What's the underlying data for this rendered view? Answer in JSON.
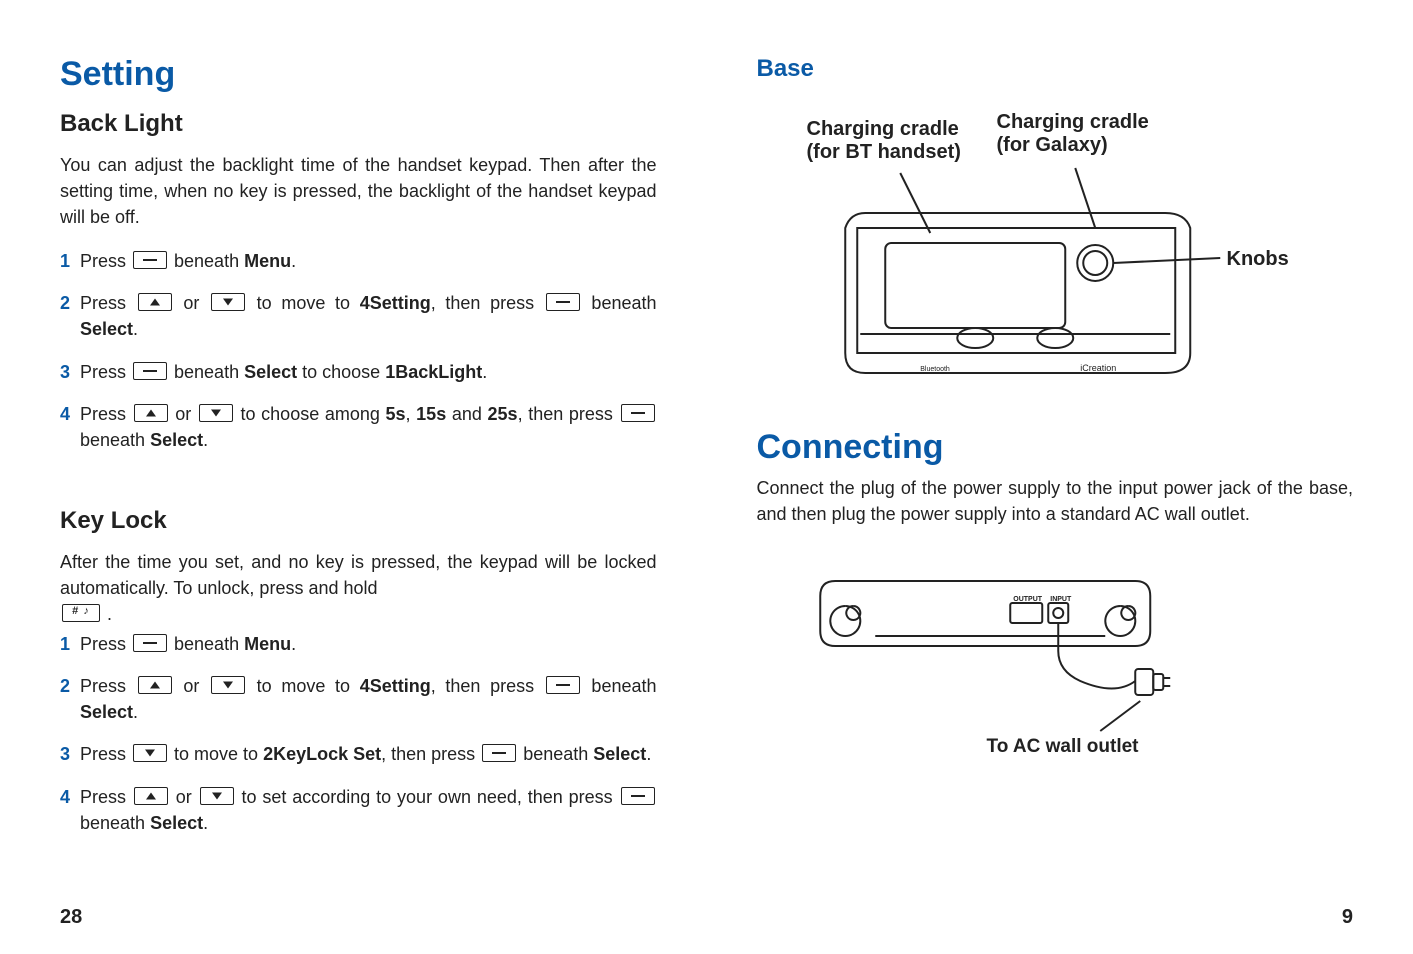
{
  "left": {
    "h1": "Setting",
    "backlight": {
      "heading": "Back Light",
      "intro": "You can adjust the backlight time of the handset keypad. Then after the setting time, when no key is pressed, the backlight of the handset keypad will be off.",
      "steps": {
        "s1a": "Press ",
        "s1b": " beneath ",
        "s1menu": "Menu",
        "s1c": ".",
        "s2a": "Press ",
        "s2b": " or ",
        "s2c": " to move to ",
        "s2target": "4Setting",
        "s2d": ", then press ",
        "s2e": " beneath ",
        "s2select": "Select",
        "s2f": ".",
        "s3a": "Press ",
        "s3b": " beneath ",
        "s3select": "Select",
        "s3c": " to choose ",
        "s3target": "1BackLight",
        "s3d": ".",
        "s4a": "Press ",
        "s4b": " or ",
        "s4c": " to choose among ",
        "s4o1": "5s",
        "s4comma": ", ",
        "s4o2": "15s",
        "s4and": " and ",
        "s4o3": "25s",
        "s4d": ", then press ",
        "s4e": " beneath ",
        "s4select": "Select",
        "s4f": "."
      }
    },
    "keylock": {
      "heading": "Key Lock",
      "intro": "After the time you set, and no key is pressed, the keypad will be locked automatically. To unlock, press and hold ",
      "intro_end": " .",
      "steps": {
        "s1a": "Press ",
        "s1b": " beneath ",
        "s1menu": "Menu",
        "s1c": ".",
        "s2a": "Press ",
        "s2b": " or ",
        "s2c": " to move to ",
        "s2target": "4Setting",
        "s2d": ", then press ",
        "s2e": " beneath ",
        "s2select": "Select",
        "s2f": ".",
        "s3a": "Press ",
        "s3b": " to move to ",
        "s3target": "2KeyLock Set",
        "s3c": ", then press ",
        "s3d": " beneath ",
        "s3select": "Select",
        "s3e": ".",
        "s4a": "Press ",
        "s4b": " or ",
        "s4c": " to set according to your own need, then press ",
        "s4d": " beneath ",
        "s4select": "Select",
        "s4e": "."
      }
    },
    "page_num": "28"
  },
  "right": {
    "base_heading": "Base",
    "labels": {
      "cradle_bt": "Charging cradle (for BT handset)",
      "cradle_galaxy": "Charging cradle (for Galaxy)",
      "knobs": "Knobs",
      "icreation": "iCreation",
      "bluetooth": "Bluetooth"
    },
    "connecting_heading": "Connecting",
    "connecting_body": "Connect the plug of the power supply to the input power jack of the base, and then plug the power supply into a standard AC wall outlet.",
    "ac_label": "To AC wall outlet",
    "output_label": "OUTPUT",
    "input_label": "INPUT",
    "page_num": "9"
  },
  "nums": {
    "n1": "1",
    "n2": "2",
    "n3": "3",
    "n4": "4"
  }
}
